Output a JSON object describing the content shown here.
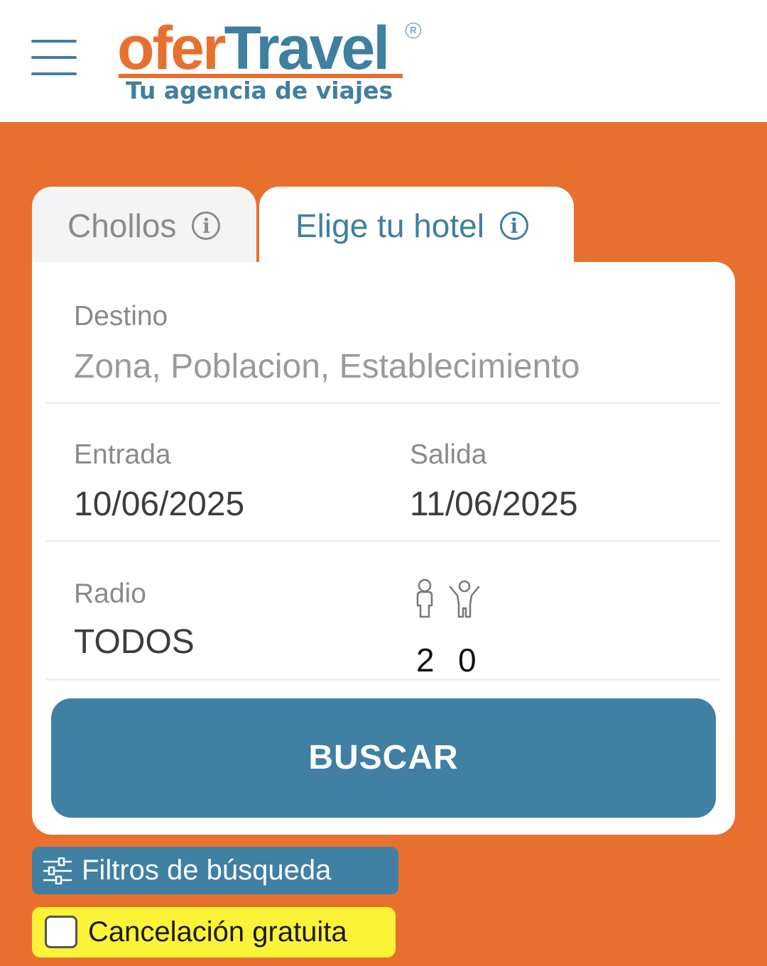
{
  "header": {
    "logo_part1": "ofer",
    "logo_part2": "Travel",
    "logo_registered": "R",
    "tagline": "Tu agencia de viajes"
  },
  "tabs": [
    {
      "label": "Chollos",
      "active": false
    },
    {
      "label": "Elige tu hotel",
      "active": true
    }
  ],
  "form": {
    "destino_label": "Destino",
    "destino_placeholder": "Zona, Poblacion, Establecimiento",
    "entrada_label": "Entrada",
    "entrada_value": "10/06/2025",
    "salida_label": "Salida",
    "salida_value": "11/06/2025",
    "radio_label": "Radio",
    "radio_value": "TODOS",
    "adults_count": "2",
    "children_count": "0",
    "search_button": "BUSCAR"
  },
  "filters": {
    "toggle_label": "Filtros de búsqueda",
    "free_cancellation_label": "Cancelación gratuita",
    "free_cancellation_checked": false
  },
  "colors": {
    "brand_orange": "#e8702f",
    "brand_blue": "#3f80a3",
    "highlight_yellow": "#fbf337"
  }
}
